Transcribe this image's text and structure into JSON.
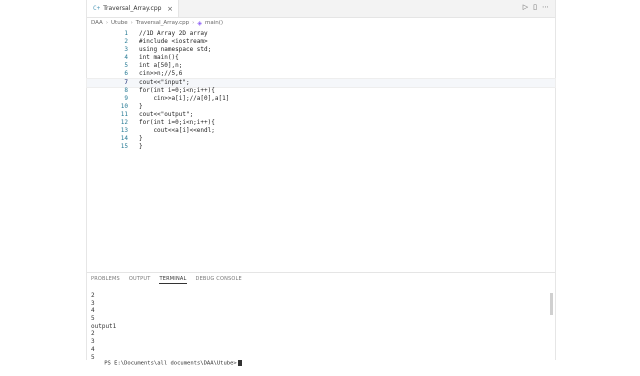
{
  "tab": {
    "filename": "Traversal_Array.cpp",
    "icon": "cpp-file-icon"
  },
  "breadcrumb": [
    "DAA",
    "Utube",
    "Traversal_Array.cpp",
    "main()"
  ],
  "code": [
    {
      "n": "1",
      "text": "//1D Array 2D array"
    },
    {
      "n": "2",
      "text": "#include <iostream>"
    },
    {
      "n": "3",
      "text": "using namespace std;"
    },
    {
      "n": "4",
      "text": "int main(){"
    },
    {
      "n": "5",
      "text": "int a[50],n;"
    },
    {
      "n": "6",
      "text": "cin>>n;//5,6"
    },
    {
      "n": "7",
      "text": "cout<<\"input\";"
    },
    {
      "n": "8",
      "text": "for(int i=0;i<n;i++){"
    },
    {
      "n": "9",
      "text": "    cin>>a[i];//a[0],a[1]"
    },
    {
      "n": "10",
      "text": "}"
    },
    {
      "n": "11",
      "text": "cout<<\"output\";"
    },
    {
      "n": "12",
      "text": "for(int i=0;i<n;i++){"
    },
    {
      "n": "13",
      "text": "    cout<<a[i]<<endl;"
    },
    {
      "n": "14",
      "text": "}"
    },
    {
      "n": "15",
      "text": "}"
    }
  ],
  "panel": {
    "tabs": [
      "PROBLEMS",
      "OUTPUT",
      "TERMINAL",
      "DEBUG CONSOLE"
    ],
    "active": "TERMINAL"
  },
  "terminal": [
    "2",
    "3",
    "4",
    "5",
    "output1",
    "2",
    "3",
    "4",
    "5"
  ],
  "prompt": "PS E:\\Documents\\all documents\\DAA\\Utube>"
}
